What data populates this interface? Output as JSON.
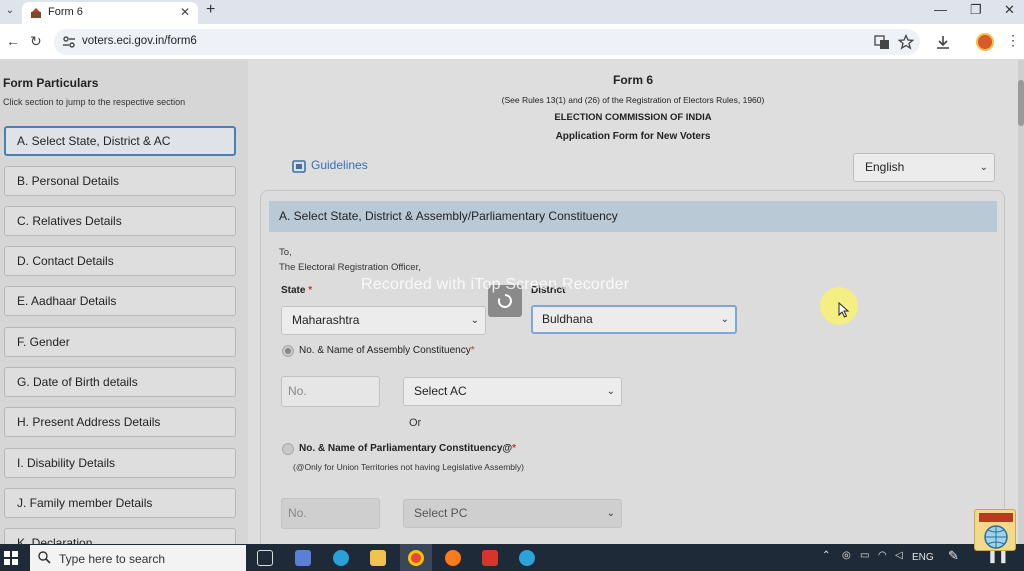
{
  "browser": {
    "tab_title": "Form 6",
    "url": "voters.eci.gov.in/form6"
  },
  "sidebar": {
    "title": "Form Particulars",
    "subtitle": "Click section to jump to the respective section",
    "items": [
      {
        "label": "A. Select State, District & AC",
        "active": true
      },
      {
        "label": "B. Personal Details"
      },
      {
        "label": "C. Relatives Details"
      },
      {
        "label": "D. Contact Details"
      },
      {
        "label": "E. Aadhaar Details"
      },
      {
        "label": "F. Gender"
      },
      {
        "label": "G. Date of Birth details"
      },
      {
        "label": "H. Present Address Details"
      },
      {
        "label": "I. Disability Details"
      },
      {
        "label": "J. Family member Details"
      },
      {
        "label": "K. Declaration"
      }
    ]
  },
  "header": {
    "title": "Form 6",
    "rules": "(See Rules 13(1) and (26) of the Registration of Electors Rules, 1960)",
    "commission": "ELECTION COMMISSION OF INDIA",
    "application": "Application Form for New Voters"
  },
  "guidelines_label": "Guidelines",
  "language": "English",
  "section": {
    "heading": "A. Select State, District & Assembly/Parliamentary Constituency",
    "to": "To,",
    "officer": "The Electoral Registration Officer,",
    "state_label": "State",
    "state_value": "Maharashtra",
    "district_label": "District",
    "district_value": "Buldhana",
    "ac_option_label": "No. & Name of Assembly Constituency",
    "ac_no_placeholder": "No.",
    "ac_select": "Select AC",
    "or_label": "Or",
    "pc_option_label": "No. & Name of Parliamentary Constituency@",
    "pc_note": "(@Only for Union Territories not having Legislative Assembly)",
    "pc_no_placeholder": "No.",
    "pc_select": "Select PC",
    "required_mark": "*"
  },
  "overlay": {
    "watermark": "Recorded with iTop Screen Recorder"
  },
  "taskbar": {
    "search_placeholder": "Type here to search",
    "language": "ENG"
  },
  "colors": {
    "accent": "#3c6fb0",
    "section_header": "#b9c9d6",
    "required": "#c0392b",
    "taskbar": "#1f2a38"
  }
}
